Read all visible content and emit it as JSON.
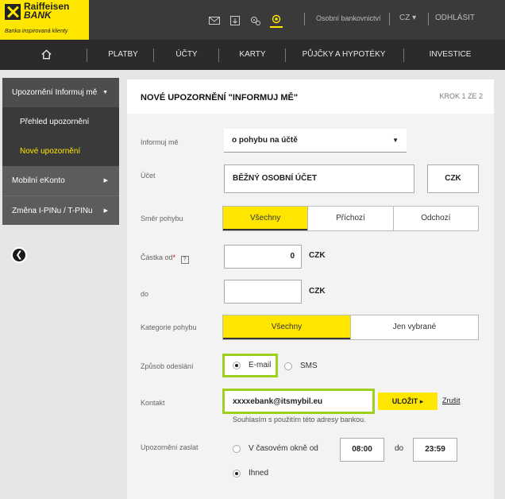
{
  "brand": {
    "name_line1": "Raiffeisen",
    "name_line2": "BANK",
    "tagline": "Banka inspirovaná klienty",
    "color": "#fee600"
  },
  "top": {
    "icons": [
      "envelope-icon",
      "document-icon",
      "gears-icon",
      "settings-icon"
    ],
    "personal_banker": "Osobní bankovnictví",
    "language": "CZ ▾",
    "logout": "ODHLÁSIT"
  },
  "nav": {
    "home_icon": "home-icon",
    "items": [
      "PLATBY",
      "ÚČTY",
      "KARTY",
      "PŮJČKY A HYPOTÉKY",
      "INVESTICE"
    ]
  },
  "sidebar": {
    "items": [
      {
        "label": "Upozornění Informuj mě",
        "caret": "▼"
      },
      {
        "label": "Přehled upozornění"
      },
      {
        "label": "Nové upozornění"
      },
      {
        "label": "Mobilní eKonto",
        "caret": "▶"
      },
      {
        "label": "Změna I-PINu / T-PINu",
        "caret": "▶"
      }
    ],
    "collapse_glyph": "❮"
  },
  "panel": {
    "title": "NOVÉ UPOZORNĚNÍ \"INFORMUJ MĚ\"",
    "step": "KROK 1 ZE 2"
  },
  "form": {
    "notify_label": "Informuj mě",
    "notify_value": "o pohybu na účtě",
    "account_label": "Účet",
    "account_value": "BĚŽNÝ OSOBNÍ ÚČET",
    "account_currency": "CZK",
    "direction_label": "Směr pohybu",
    "direction_options": [
      "Všechny",
      "Příchozí",
      "Odchozí"
    ],
    "amount_from_label": "Částka od",
    "required_mark": "*",
    "help_glyph": "?",
    "amount_from_value": "0",
    "amount_currency": "CZK",
    "amount_to_label": "do",
    "amount_to_value": "",
    "amount_to_currency": "CZK",
    "category_label": "Kategorie pohybu",
    "category_options": [
      "Všechny",
      "Jen vybrané"
    ],
    "send_method_label": "Způsob odeslání",
    "send_options": [
      "E-mail",
      "SMS"
    ],
    "contact_label": "Kontakt",
    "contact_value": "xxxxebank@itsmybil.eu",
    "save_label": "ULOŽIT ▸",
    "cancel_label": "Zrušit",
    "consent_note": "Souhlasím s použitím této adresy bankou.",
    "send_time_label": "Upozornění zaslat",
    "time_window_label": "V časovém okně od",
    "time_from": "08:00",
    "time_to_label": "do",
    "time_to": "23:59",
    "immediately_label": "Ihned"
  }
}
